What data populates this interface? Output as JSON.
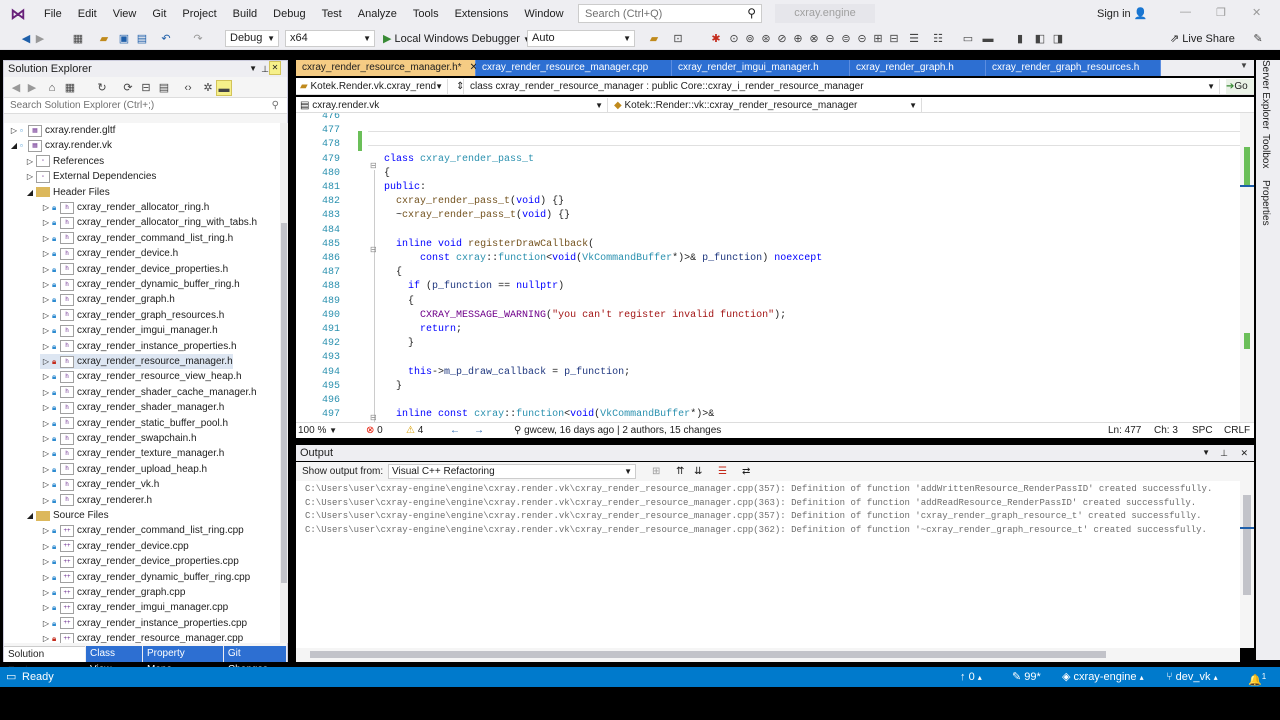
{
  "menu": [
    "File",
    "Edit",
    "View",
    "Git",
    "Project",
    "Build",
    "Debug",
    "Test",
    "Analyze",
    "Tools",
    "Extensions",
    "Window",
    "Help"
  ],
  "search_placeholder": "Search (Ctrl+Q)",
  "project_badge": "cxray.engine",
  "sign_in": "Sign in",
  "toolbar": {
    "config": "Debug",
    "platform": "x64",
    "debugger": "Local Windows Debugger",
    "auto": "Auto",
    "live_share": "Live Share"
  },
  "solution_explorer": {
    "title": "Solution Explorer",
    "search_placeholder": "Search Solution Explorer (Ctrl+;)",
    "items": [
      {
        "label": "cxray.render.gltf",
        "level": 1,
        "kind": "proj",
        "expanded": false
      },
      {
        "label": "cxray.render.vk",
        "level": 1,
        "kind": "proj",
        "expanded": true
      },
      {
        "label": "References",
        "level": 2,
        "kind": "ref",
        "expanded": false
      },
      {
        "label": "External Dependencies",
        "level": 2,
        "kind": "ref",
        "expanded": false
      },
      {
        "label": "Header Files",
        "level": 2,
        "kind": "folder",
        "expanded": true
      },
      {
        "label": "cxray_render_allocator_ring.h",
        "level": 3,
        "kind": "h"
      },
      {
        "label": "cxray_render_allocator_ring_with_tabs.h",
        "level": 3,
        "kind": "h"
      },
      {
        "label": "cxray_render_command_list_ring.h",
        "level": 3,
        "kind": "h"
      },
      {
        "label": "cxray_render_device.h",
        "level": 3,
        "kind": "h"
      },
      {
        "label": "cxray_render_device_properties.h",
        "level": 3,
        "kind": "h"
      },
      {
        "label": "cxray_render_dynamic_buffer_ring.h",
        "level": 3,
        "kind": "h"
      },
      {
        "label": "cxray_render_graph.h",
        "level": 3,
        "kind": "h"
      },
      {
        "label": "cxray_render_graph_resources.h",
        "level": 3,
        "kind": "h"
      },
      {
        "label": "cxray_render_imgui_manager.h",
        "level": 3,
        "kind": "h"
      },
      {
        "label": "cxray_render_instance_properties.h",
        "level": 3,
        "kind": "h"
      },
      {
        "label": "cxray_render_resource_manager.h",
        "level": 3,
        "kind": "h"
      },
      {
        "label": "cxray_render_resource_view_heap.h",
        "level": 3,
        "kind": "h"
      },
      {
        "label": "cxray_render_shader_cache_manager.h",
        "level": 3,
        "kind": "h"
      },
      {
        "label": "cxray_render_shader_manager.h",
        "level": 3,
        "kind": "h"
      },
      {
        "label": "cxray_render_static_buffer_pool.h",
        "level": 3,
        "kind": "h"
      },
      {
        "label": "cxray_render_swapchain.h",
        "level": 3,
        "kind": "h"
      },
      {
        "label": "cxray_render_texture_manager.h",
        "level": 3,
        "kind": "h"
      },
      {
        "label": "cxray_render_upload_heap.h",
        "level": 3,
        "kind": "h"
      },
      {
        "label": "cxray_render_vk.h",
        "level": 3,
        "kind": "h"
      },
      {
        "label": "cxray_renderer.h",
        "level": 3,
        "kind": "h"
      },
      {
        "label": "Source Files",
        "level": 2,
        "kind": "folder",
        "expanded": true
      },
      {
        "label": "cxray_render_command_list_ring.cpp",
        "level": 3,
        "kind": "cpp"
      },
      {
        "label": "cxray_render_device.cpp",
        "level": 3,
        "kind": "cpp"
      },
      {
        "label": "cxray_render_device_properties.cpp",
        "level": 3,
        "kind": "cpp"
      },
      {
        "label": "cxray_render_dynamic_buffer_ring.cpp",
        "level": 3,
        "kind": "cpp"
      },
      {
        "label": "cxray_render_graph.cpp",
        "level": 3,
        "kind": "cpp"
      },
      {
        "label": "cxray_render_imgui_manager.cpp",
        "level": 3,
        "kind": "cpp"
      },
      {
        "label": "cxray_render_instance_properties.cpp",
        "level": 3,
        "kind": "cpp"
      },
      {
        "label": "cxray_render_resource_manager.cpp",
        "level": 3,
        "kind": "cpp"
      }
    ],
    "bottom_tabs": [
      "Solution Explor...",
      "Class View",
      "Property Mana...",
      "Git Changes"
    ]
  },
  "doc_tabs": [
    {
      "label": "cxray_render_resource_manager.h*",
      "active": true
    },
    {
      "label": "cxray_render_resource_manager.cpp",
      "active": false
    },
    {
      "label": "cxray_render_imgui_manager.h",
      "active": false
    },
    {
      "label": "cxray_render_graph.h",
      "active": false
    },
    {
      "label": "cxray_render_graph_resources.h",
      "active": false
    }
  ],
  "nav": {
    "project": "Kotek.Render.vk.cxray_rend",
    "scope": "class cxray_render_resource_manager : public Core::cxray_i_render_resource_manager",
    "file": "cxray.render.vk",
    "member": "Kotek::Render::vk::cxray_render_resource_manager",
    "go": "Go"
  },
  "code_lines": [
    {
      "n": "476",
      "html": ""
    },
    {
      "n": "477",
      "html": ""
    },
    {
      "n": "478",
      "html": ""
    },
    {
      "n": "479",
      "html": "<span class='kw'>class</span> <span class='ty'>cxray_render_pass_t</span>"
    },
    {
      "n": "480",
      "html": "{"
    },
    {
      "n": "481",
      "html": "<span class='kw'>public</span>:"
    },
    {
      "n": "482",
      "html": "  <span class='fn'>cxray_render_pass_t</span>(<span class='kw'>void</span>) {}"
    },
    {
      "n": "483",
      "html": "  ~<span class='fn'>cxray_render_pass_t</span>(<span class='kw'>void</span>) {}"
    },
    {
      "n": "484",
      "html": ""
    },
    {
      "n": "485",
      "html": "  <span class='kw'>inline</span> <span class='kw'>void</span> <span class='fn'>registerDrawCallback</span>("
    },
    {
      "n": "486",
      "html": "      <span class='kw'>const</span> <span class='ty'>cxray</span>::<span class='ty'>function</span>&lt;<span class='kw'>void</span>(<span class='ty'>VkCommandBuffer</span>*)&gt;&amp; <span class='pa'>p_function</span>) <span class='kw'>noexcept</span>"
    },
    {
      "n": "487",
      "html": "  {"
    },
    {
      "n": "488",
      "html": "    <span class='kw'>if</span> (<span class='pa'>p_function</span> == <span class='kw'>nullptr</span>)"
    },
    {
      "n": "489",
      "html": "    {"
    },
    {
      "n": "490",
      "html": "      <span class='mc'>CXRAY_MESSAGE_WARNING</span>(<span class='st'>\"you can't register invalid function\"</span>);"
    },
    {
      "n": "491",
      "html": "      <span class='kw'>return</span>;"
    },
    {
      "n": "492",
      "html": "    }"
    },
    {
      "n": "493",
      "html": ""
    },
    {
      "n": "494",
      "html": "    <span class='kw'>this</span>-&gt;<span class='pa'>m_p_draw_callback</span> = <span class='pa'>p_function</span>;"
    },
    {
      "n": "495",
      "html": "  }"
    },
    {
      "n": "496",
      "html": ""
    },
    {
      "n": "497",
      "html": "  <span class='kw'>inline</span> <span class='kw'>const</span> <span class='ty'>cxray</span>::<span class='ty'>function</span>&lt;<span class='kw'>void</span>(<span class='ty'>VkCommandBuffer</span>*)&gt;&amp;"
    }
  ],
  "editor_status": {
    "zoom": "100 %",
    "errors": "0",
    "warnings": "4",
    "author": "gwcew, 16 days ago",
    "changes": "2 authors, 15 changes",
    "ln": "Ln: 477",
    "ch": "Ch: 3",
    "spc": "SPC",
    "crlf": "CRLF"
  },
  "output": {
    "title": "Output",
    "show_from_label": "Show output from:",
    "source": "Visual C++ Refactoring",
    "lines": [
      "C:\\Users\\user\\cxray-engine\\engine\\cxray.render.vk\\cxray_render_resource_manager.cpp(357): Definition of function 'addWrittenResource_RenderPassID' created successfully.",
      "C:\\Users\\user\\cxray-engine\\engine\\cxray.render.vk\\cxray_render_resource_manager.cpp(363): Definition of function 'addReadResource_RenderPassID' created successfully.",
      "C:\\Users\\user\\cxray-engine\\engine\\cxray.render.vk\\cxray_render_resource_manager.cpp(357): Definition of function 'cxray_render_graph_resource_t' created successfully.",
      "C:\\Users\\user\\cxray-engine\\engine\\cxray.render.vk\\cxray_render_resource_manager.cpp(362): Definition of function '~cxray_render_graph_resource_t' created successfully."
    ]
  },
  "right_tabs": [
    "Server Explorer",
    "Toolbox",
    "Properties"
  ],
  "statusbar": {
    "ready": "Ready",
    "up": "0",
    "pencil": "99*",
    "repo": "cxray-engine",
    "branch": "dev_vk",
    "notif": "1"
  }
}
